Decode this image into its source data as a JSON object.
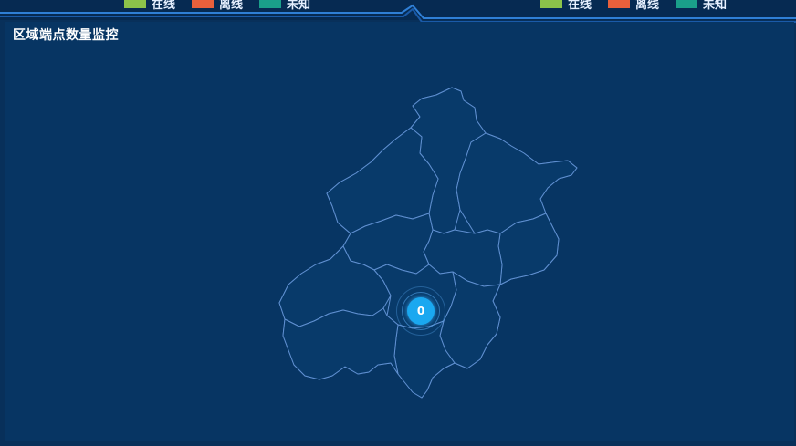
{
  "legend_left": [
    {
      "label": "在线",
      "color": "#8bc34a"
    },
    {
      "label": "离线",
      "color": "#e8603c"
    },
    {
      "label": "未知",
      "color": "#1a9f8a"
    }
  ],
  "legend_right": [
    {
      "label": "在线",
      "color": "#8bc34a"
    },
    {
      "label": "离线",
      "color": "#e8603c"
    },
    {
      "label": "未知",
      "color": "#1a9f8a"
    }
  ],
  "panel": {
    "title": "区域端点数量监控"
  },
  "map": {
    "marker_value": "0",
    "boundary_color": "#5f8fd0",
    "marker_color": "#1aa8f0"
  }
}
